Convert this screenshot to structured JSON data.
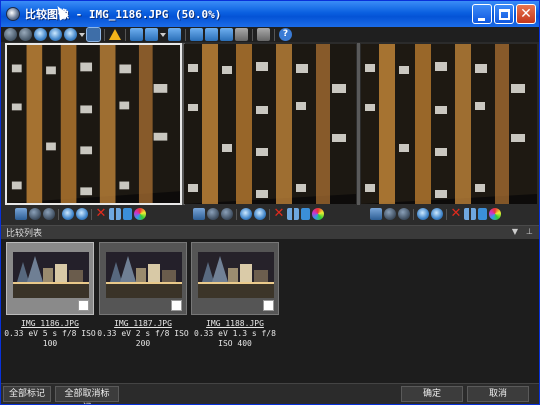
{
  "window": {
    "title": "比较图像 - IMG_1186.JPG (50.0%)"
  },
  "compare_list": {
    "label": "比较列表",
    "items": [
      {
        "file": "IMG_1186.JPG",
        "info": "0.33 eV 5 s f/8 ISO 100",
        "selected": true
      },
      {
        "file": "IMG_1187.JPG",
        "info": "0.33 eV 2 s f/8 ISO 200",
        "selected": false
      },
      {
        "file": "IMG_1188.JPG",
        "info": "0.33 eV 1.3 s f/8 ISO 400",
        "selected": false
      }
    ]
  },
  "footer": {
    "mark_all": "全部标记",
    "unmark_all": "全部取消标记",
    "ok": "确定",
    "cancel": "取消"
  },
  "colors": {
    "titlebar": "#0a5fe0",
    "background": "#2b2b2b",
    "selected_border": "#e8e8e8"
  }
}
